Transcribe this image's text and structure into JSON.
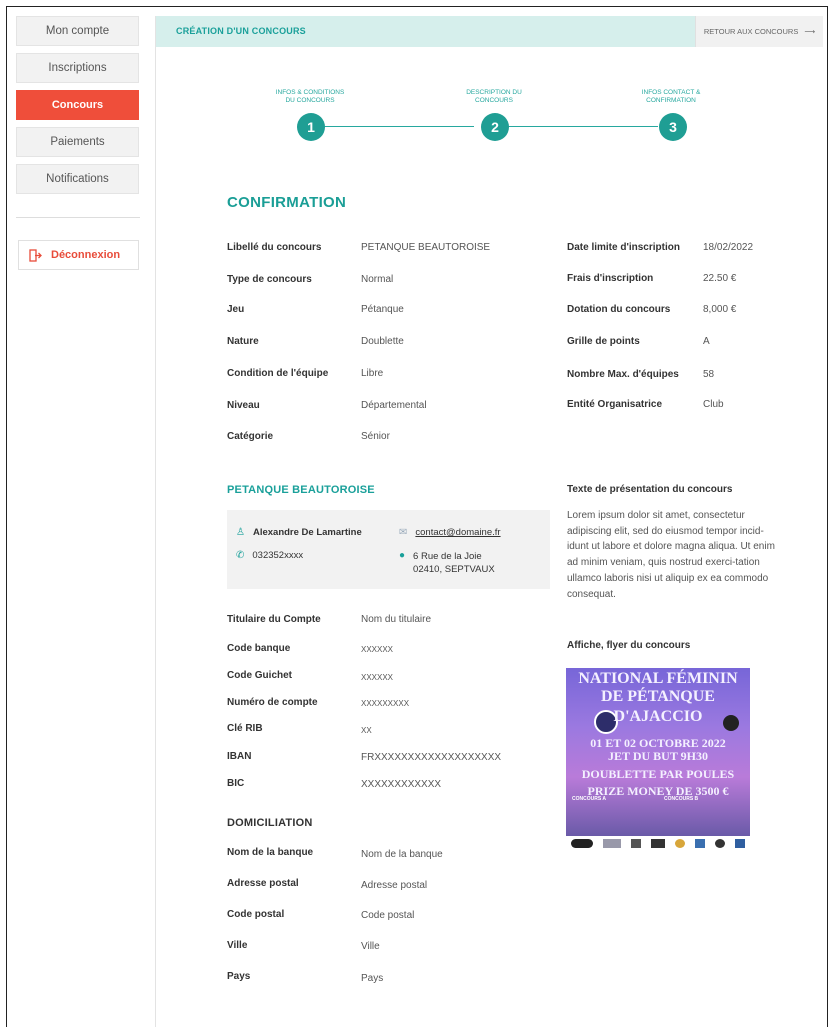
{
  "sidebar": {
    "items": [
      {
        "label": "Mon compte",
        "active": false
      },
      {
        "label": "Inscriptions",
        "active": false
      },
      {
        "label": "Concours",
        "active": true
      },
      {
        "label": "Paiements",
        "active": false
      },
      {
        "label": "Notifications",
        "active": false
      }
    ],
    "logout_label": "Déconnexion"
  },
  "header": {
    "title": "CRÉATION D'UN CONCOURS",
    "back_label": "RETOUR AUX CONCOURS"
  },
  "steps": [
    {
      "label_line1": "INFOS & CONDITIONS",
      "label_line2": "DU CONCOURS",
      "number": "1"
    },
    {
      "label_line1": "DESCRIPTION DU",
      "label_line2": "CONCOURS",
      "number": "2"
    },
    {
      "label_line1": "INFOS CONTACT &",
      "label_line2": "CONFIRMATION",
      "number": "3"
    }
  ],
  "confirmation": {
    "heading": "CONFIRMATION",
    "left_fields": [
      {
        "label": "Libellé du concours",
        "value": "PETANQUE BEAUTOROISE"
      },
      {
        "label": "Type de concours",
        "value": "Normal"
      },
      {
        "label": "Jeu",
        "value": "Pétanque"
      },
      {
        "label": "Nature",
        "value": "Doublette"
      },
      {
        "label": "Condition de l'équipe",
        "value": "Libre"
      },
      {
        "label": "Niveau",
        "value": "Départemental"
      },
      {
        "label": "Catégorie",
        "value": "Sénior"
      }
    ],
    "right_fields": [
      {
        "label": "Date limite d'inscription",
        "value": "18/02/2022"
      },
      {
        "label": "Frais d'inscription",
        "value": "22.50 €"
      },
      {
        "label": "Dotation du concours",
        "value": "8,000 €"
      },
      {
        "label": "Grille de points",
        "value": "A"
      },
      {
        "label": "Nombre Max. d'équipes",
        "value": "58"
      },
      {
        "label": "Entité Organisatrice",
        "value": "Club"
      }
    ]
  },
  "club": {
    "heading": "PETANQUE BEAUTOROISE",
    "contact_name": "Alexandre De Lamartine",
    "email": "contact@domaine.fr",
    "phone": "032352xxxx",
    "address_line1": "6 Rue de la Joie",
    "address_line2": "02410, SEPTVAUX"
  },
  "bank": {
    "fields": [
      {
        "label": "Titulaire du Compte",
        "value": "Nom du titulaire"
      },
      {
        "label": "Code banque",
        "value": "XXXXXX"
      },
      {
        "label": "Code Guichet",
        "value": "XXXXXX"
      },
      {
        "label": "Numéro de compte",
        "value": "XXXXXXXXX"
      },
      {
        "label": "Clé RIB",
        "value": "XX"
      },
      {
        "label": "IBAN",
        "value": "FRXXXXXXXXXXXXXXXXXXX"
      },
      {
        "label": "BIC",
        "value": "XXXXXXXXXXXX"
      }
    ]
  },
  "domiciliation": {
    "heading": "DOMICILIATION",
    "fields": [
      {
        "label": "Nom de la banque",
        "value": "Nom de la banque"
      },
      {
        "label": "Adresse postal",
        "value": "Adresse postal"
      },
      {
        "label": "Code postal",
        "value": "Code postal"
      },
      {
        "label": "Ville",
        "value": "Ville"
      },
      {
        "label": "Pays",
        "value": "Pays"
      }
    ]
  },
  "presentation": {
    "heading": "Texte de présentation du concours",
    "text": "Lorem ipsum dolor sit amet, consectetur adipiscing elit, sed do eiusmod tempor incid-idunt ut labore et dolore magna aliqua. Ut enim ad minim veniam, quis nostrud exerci-tation ullamco laboris nisi ut aliquip ex ea commodo consequat."
  },
  "poster": {
    "heading": "Affiche, flyer du concours",
    "line1": "NATIONAL FÉMININ",
    "line2": "DE PÉTANQUE",
    "line3": "D'AJACCIO",
    "line4": "01 ET 02 OCTOBRE 2022",
    "line5": "JET DU BUT 9H30",
    "line6": "DOUBLETTE PAR POULES",
    "line7": "PRIZE MONEY DE 3500 €",
    "col_a_title": "CONCOURS A",
    "col_b_title": "CONCOURS B"
  },
  "colors": {
    "accent": "#1aa09a",
    "active_nav": "#ef4e3a",
    "header_bg": "#d6efec"
  }
}
